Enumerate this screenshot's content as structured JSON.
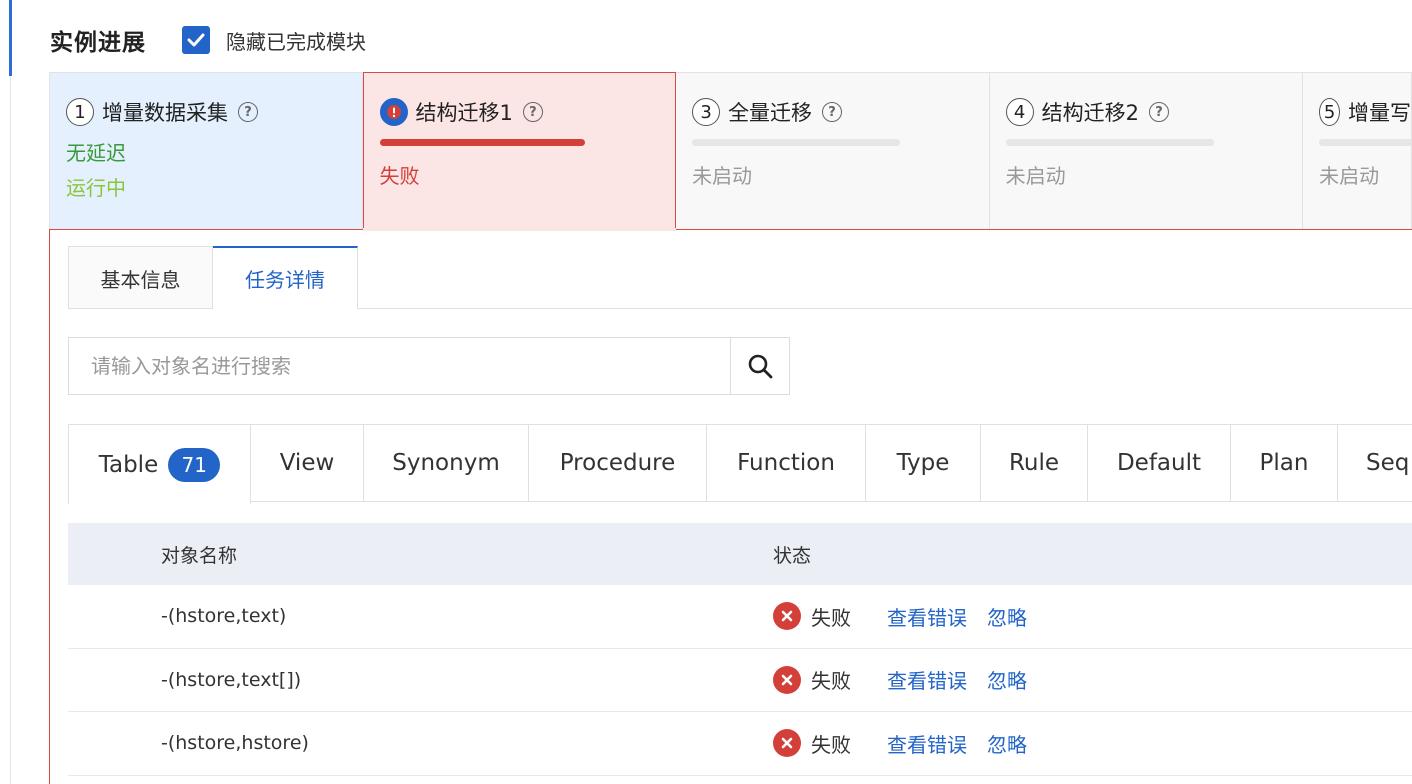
{
  "header": {
    "title": "实例进展",
    "hide_completed_label": "隐藏已完成模块",
    "hide_completed_checked": true
  },
  "steps": [
    {
      "number": "1",
      "name": "增量数据采集",
      "status_primary": "无延迟",
      "status_secondary": "运行中",
      "state": "running"
    },
    {
      "number": "",
      "name": "结构迁移1",
      "status": "失败",
      "state": "failed"
    },
    {
      "number": "3",
      "name": "全量迁移",
      "status": "未启动",
      "state": "not_started"
    },
    {
      "number": "4",
      "name": "结构迁移2",
      "status": "未启动",
      "state": "not_started"
    },
    {
      "number": "5",
      "name": "增量写",
      "status": "未启动",
      "state": "not_started"
    }
  ],
  "tabs": [
    {
      "label": "基本信息",
      "active": false
    },
    {
      "label": "任务详情",
      "active": true
    }
  ],
  "search": {
    "placeholder": "请输入对象名进行搜索",
    "value": ""
  },
  "object_types": [
    {
      "label": "Table",
      "count": "71",
      "active": true
    },
    {
      "label": "View"
    },
    {
      "label": "Synonym"
    },
    {
      "label": "Procedure"
    },
    {
      "label": "Function"
    },
    {
      "label": "Type"
    },
    {
      "label": "Rule"
    },
    {
      "label": "Default"
    },
    {
      "label": "Plan"
    },
    {
      "label": "Seq"
    }
  ],
  "table": {
    "columns": [
      "对象名称",
      "状态"
    ],
    "rows": [
      {
        "name": "-(hstore,text)",
        "status": "失败",
        "actions": [
          "查看错误",
          "忽略"
        ]
      },
      {
        "name": "-(hstore,text[])",
        "status": "失败",
        "actions": [
          "查看错误",
          "忽略"
        ]
      },
      {
        "name": "-(hstore,hstore)",
        "status": "失败",
        "actions": [
          "查看错误",
          "忽略"
        ]
      }
    ]
  },
  "colors": {
    "primary": "#2364c8",
    "failed": "#d3403a",
    "success": "#3a9a3a",
    "running": "#8ac53a"
  }
}
